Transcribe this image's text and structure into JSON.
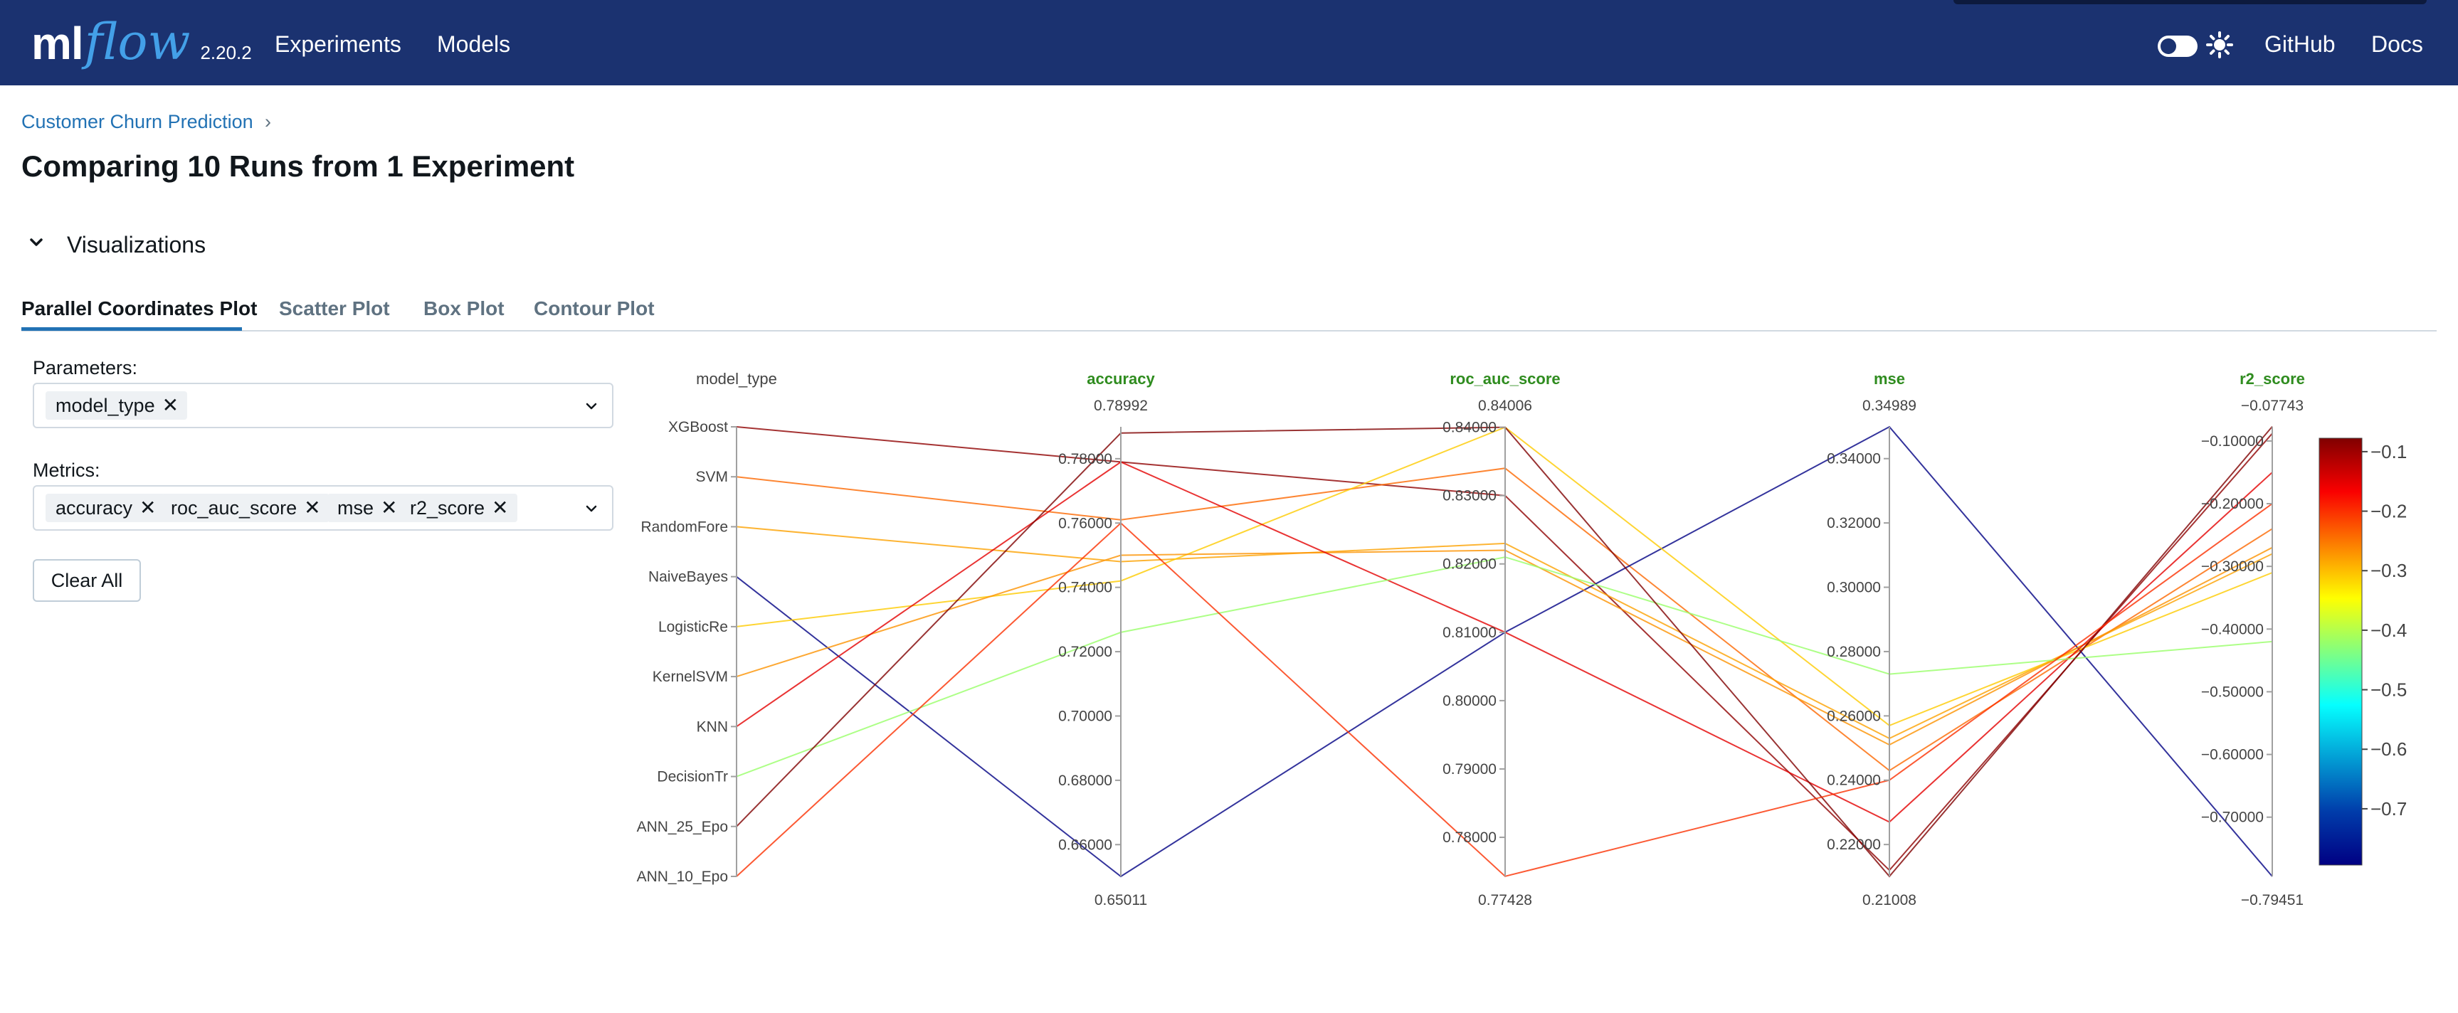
{
  "app": {
    "logo_ml": "ml",
    "logo_flow": "flow",
    "version": "2.20.2",
    "nav": [
      "Experiments",
      "Models"
    ],
    "right_links": [
      "GitHub",
      "Docs"
    ]
  },
  "breadcrumb": {
    "experiment": "Customer Churn Prediction",
    "separator": "›"
  },
  "page_title": "Comparing 10 Runs from 1 Experiment",
  "section": {
    "title": "Visualizations",
    "expanded": true
  },
  "tabs": [
    {
      "label": "Parallel Coordinates Plot",
      "active": true
    },
    {
      "label": "Scatter Plot",
      "active": false
    },
    {
      "label": "Box Plot",
      "active": false
    },
    {
      "label": "Contour Plot",
      "active": false
    }
  ],
  "parameters": {
    "label": "Parameters:",
    "selected": [
      "model_type"
    ]
  },
  "metrics": {
    "label": "Metrics:",
    "selected": [
      "accuracy",
      "roc_auc_score",
      "mse",
      "r2_score"
    ]
  },
  "clear_all_label": "Clear All",
  "colors": {
    "header_bg": "#1b3270",
    "accent": "#2272b4",
    "metric_label": "#2f8c1f"
  },
  "chart_data": {
    "type": "parallel_coordinates",
    "colorscale": "Jet",
    "color_by": "r2_score",
    "axes": [
      {
        "name": "model_type",
        "categorical": true,
        "categories": [
          "XGBoost",
          "SVM",
          "RandomFore",
          "NaiveBayes",
          "LogisticRe",
          "KernelSVM",
          "KNN",
          "DecisionTr",
          "ANN_25_Epo",
          "ANN_10_Epo"
        ]
      },
      {
        "name": "accuracy",
        "range": [
          0.65011,
          0.78992
        ],
        "range_labels": [
          "0.65011",
          "0.78992"
        ],
        "ticks": [
          0.66,
          0.68,
          0.7,
          0.72,
          0.74,
          0.76,
          0.78
        ],
        "tick_labels": [
          "0.66000",
          "0.68000",
          "0.70000",
          "0.72000",
          "0.74000",
          "0.76000",
          "0.78000"
        ]
      },
      {
        "name": "roc_auc_score",
        "range": [
          0.77428,
          0.84006
        ],
        "range_labels": [
          "0.77428",
          "0.84006"
        ],
        "ticks": [
          0.78,
          0.79,
          0.8,
          0.81,
          0.82,
          0.83,
          0.84
        ],
        "tick_labels": [
          "0.78000",
          "0.79000",
          "0.80000",
          "0.81000",
          "0.82000",
          "0.83000",
          "0.84000"
        ]
      },
      {
        "name": "mse",
        "range": [
          0.21008,
          0.34989
        ],
        "range_labels": [
          "0.21008",
          "0.34989"
        ],
        "ticks": [
          0.22,
          0.24,
          0.26,
          0.28,
          0.3,
          0.32,
          0.34
        ],
        "tick_labels": [
          "0.22000",
          "0.24000",
          "0.26000",
          "0.28000",
          "0.30000",
          "0.32000",
          "0.34000"
        ]
      },
      {
        "name": "r2_score",
        "range": [
          -0.79451,
          -0.07743
        ],
        "range_labels": [
          "−0.79451",
          "−0.07743"
        ],
        "ticks": [
          -0.7,
          -0.6,
          -0.5,
          -0.4,
          -0.3,
          -0.2,
          -0.1
        ],
        "tick_labels": [
          "−0.70000",
          "−0.60000",
          "−0.50000",
          "−0.40000",
          "−0.30000",
          "−0.20000",
          "−0.10000"
        ]
      }
    ],
    "runs": [
      {
        "model_type": "XGBoost",
        "accuracy": 0.779,
        "roc_auc_score": 0.83,
        "mse": 0.212,
        "r2_score": -0.088
      },
      {
        "model_type": "SVM",
        "accuracy": 0.761,
        "roc_auc_score": 0.834,
        "mse": 0.243,
        "r2_score": -0.24
      },
      {
        "model_type": "RandomFore",
        "accuracy": 0.748,
        "roc_auc_score": 0.823,
        "mse": 0.253,
        "r2_score": -0.28
      },
      {
        "model_type": "NaiveBayes",
        "accuracy": 0.6501,
        "roc_auc_score": 0.81,
        "mse": 0.3499,
        "r2_score": -0.7945
      },
      {
        "model_type": "LogisticRe",
        "accuracy": 0.742,
        "roc_auc_score": 0.84,
        "mse": 0.257,
        "r2_score": -0.31
      },
      {
        "model_type": "KernelSVM",
        "accuracy": 0.75,
        "roc_auc_score": 0.822,
        "mse": 0.251,
        "r2_score": -0.27
      },
      {
        "model_type": "KNN",
        "accuracy": 0.779,
        "roc_auc_score": 0.81,
        "mse": 0.227,
        "r2_score": -0.15
      },
      {
        "model_type": "DecisionTr",
        "accuracy": 0.726,
        "roc_auc_score": 0.821,
        "mse": 0.273,
        "r2_score": -0.42
      },
      {
        "model_type": "ANN_25_Epo",
        "accuracy": 0.788,
        "roc_auc_score": 0.84,
        "mse": 0.2101,
        "r2_score": -0.077
      },
      {
        "model_type": "ANN_10_Epo",
        "accuracy": 0.76,
        "roc_auc_score": 0.7743,
        "mse": 0.24,
        "r2_score": -0.2
      }
    ],
    "colorbar": {
      "range": [
        -0.79451,
        -0.07743
      ],
      "ticks": [
        -0.7,
        -0.6,
        -0.5,
        -0.4,
        -0.3,
        -0.2,
        -0.1
      ],
      "tick_labels": [
        "−0.7",
        "−0.6",
        "−0.5",
        "−0.4",
        "−0.3",
        "−0.2",
        "−0.1"
      ]
    }
  }
}
